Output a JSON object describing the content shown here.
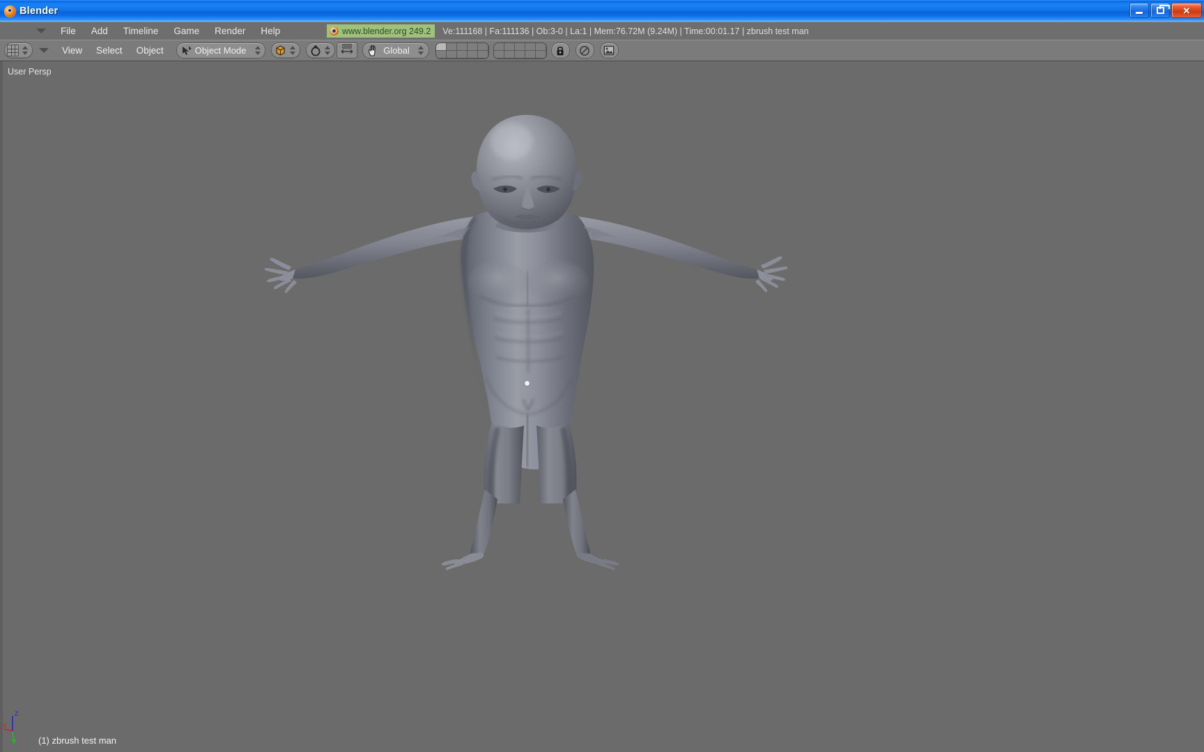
{
  "window": {
    "title": "Blender",
    "app_icon": "blender-logo-icon",
    "minimize_label": "Minimize",
    "maximize_label": "Restore",
    "close_label": "Close",
    "close_glyph": "✕"
  },
  "menubar": {
    "collapse_icon": "triangle-down-icon",
    "items": [
      {
        "label": "File"
      },
      {
        "label": "Add"
      },
      {
        "label": "Timeline"
      },
      {
        "label": "Game"
      },
      {
        "label": "Render"
      },
      {
        "label": "Help"
      }
    ],
    "badge": {
      "icon": "blender-logo-icon",
      "text": "www.blender.org 249.2",
      "bg_color": "#9ec27e",
      "text_color": "#2e4d1e"
    },
    "statistics": "Ve:111168 | Fa:111136 | Ob:3-0 | La:1  | Mem:76.72M (9.24M)  | Time:00:01.17 | zbrush test man",
    "stats_parts": {
      "vertices": "Ve:111168",
      "faces": "Fa:111136",
      "objects": "Ob:3-0",
      "lamps": "La:1",
      "memory": "Mem:76.72M (9.24M)",
      "time": "Time:00:01.17",
      "active_object": "zbrush test man"
    }
  },
  "viewheader": {
    "editor_type_icon": "grid-editor-icon",
    "editor_type_spinner": "updown-spinner-icon",
    "collapse_icon": "triangle-down-icon",
    "menus": [
      {
        "label": "View"
      },
      {
        "label": "Select"
      },
      {
        "label": "Object"
      }
    ],
    "mode_select": {
      "icon": "object-mode-cursor-icon",
      "value": "Object Mode",
      "spinner": "updown-spinner-icon"
    },
    "draw_type": {
      "icon": "solid-shading-icon",
      "spinner": "updown-spinner-icon"
    },
    "rotation_pivot": {
      "icon": "pivot-median-point-icon",
      "spinner": "updown-spinner-icon"
    },
    "manipulator": {
      "icon": "translate-manipulator-icon"
    },
    "transform_orientation": {
      "icon": "hand-cursor-icon",
      "value": "Global",
      "spinner": "updown-spinner-icon"
    },
    "layers": {
      "group_a": [
        true,
        false,
        false,
        false,
        false,
        false,
        false,
        false,
        false,
        false
      ],
      "group_b": [
        false,
        false,
        false,
        false,
        false,
        false,
        false,
        false,
        false,
        false
      ]
    },
    "lock_button": {
      "icon": "lock-icon"
    },
    "proportional_edit": {
      "icon": "circle-slash-icon"
    },
    "render_preview": {
      "icon": "render-image-icon"
    }
  },
  "viewport": {
    "perspective_label": "User Persp",
    "active_object_label": "(1) zbrush test man",
    "background_color": "#6b6b6b",
    "axis_gizmo": {
      "z_label": "Z",
      "x_label": "X",
      "y_label": "Y",
      "z_color": "#2222ee",
      "x_color": "#cc2222",
      "y_color": "#22bb22"
    },
    "object_center_dot": {
      "color": "#f2f2f2"
    },
    "model": {
      "name": "zbrush test man",
      "description": "humanoid male mesh in T-pose, solid grey shading",
      "base_color": "#8a8d96",
      "shadow_color": "#4a4d55"
    }
  }
}
